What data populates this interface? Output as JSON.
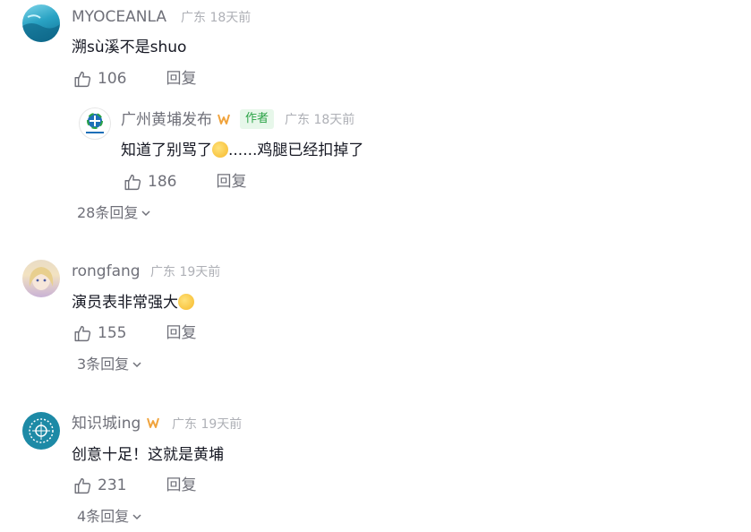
{
  "colors": {
    "username": "#6f7079",
    "meta": "#aeb0b6",
    "text": "#161823",
    "author_tag_text": "#2ba246",
    "author_tag_bg": "#e7f7ea",
    "badge": "#f0a33c"
  },
  "comments": [
    {
      "username": "MYOCEANLA",
      "location": "广东",
      "time": "18天前",
      "text": "溯sù溪不是shuo",
      "likes": "106",
      "reply_label": "回复",
      "avatar_icon": "ocean-photo"
    },
    {
      "username": "rongfang",
      "location": "广东",
      "time": "19天前",
      "text": "演员表非常强大",
      "likes": "155",
      "reply_label": "回复",
      "more_replies": "3条回复",
      "avatar_icon": "anime-girl-portrait"
    },
    {
      "username": "知识城ing",
      "location": "广东",
      "time": "19天前",
      "text": "创意十足！这就是黄埔",
      "likes": "231",
      "reply_label": "回复",
      "more_replies": "4条回复",
      "avatar_icon": "teal-emblem"
    }
  ],
  "reply": {
    "username": "广州黄埔发布",
    "author_tag": "作者",
    "location": "广东",
    "time": "18天前",
    "text_before": "知道了别骂了",
    "text_after": "......鸡腿已经扣掉了",
    "likes": "186",
    "reply_label": "回复",
    "more_replies": "28条回复",
    "avatar_icon": "huangpu-logo"
  }
}
